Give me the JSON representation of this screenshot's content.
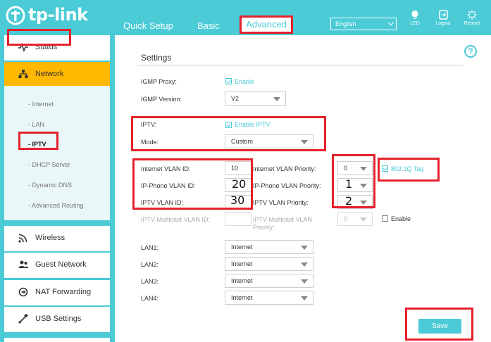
{
  "header": {
    "brand": "tp-link",
    "nav": {
      "quick_setup": "Quick Setup",
      "basic": "Basic",
      "advanced": "Advanced"
    },
    "language": "English",
    "icons": {
      "led": "LED",
      "logout": "Logout",
      "reboot": "Reboot"
    }
  },
  "sidebar": {
    "status": "Status",
    "network": "Network",
    "network_sub": [
      "Internet",
      "LAN",
      "IPTV",
      "DHCP Server",
      "Dynamic DNS",
      "Advanced Routing"
    ],
    "wireless": "Wireless",
    "guest": "Guest Network",
    "nat": "NAT Forwarding",
    "usb": "USB Settings"
  },
  "settings": {
    "title": "Settings",
    "igmp_proxy_label": "IGMP Proxy:",
    "igmp_proxy_check": "Enable",
    "igmp_version_label": "IGMP Version:",
    "igmp_version": "V2",
    "iptv_label": "IPTV:",
    "iptv_check": "Enable IPTV",
    "mode_label": "Mode:",
    "mode": "Custom",
    "internet_vlan_label": "Internet VLAN ID:",
    "internet_vlan": "10",
    "internet_prio_label": "Internet VLAN Priority:",
    "internet_prio": "0",
    "tag_check": "802.1Q Tag",
    "ipphone_vlan_label": "IP-Phone VLAN ID:",
    "ipphone_vlan": "20",
    "ipphone_prio_label": "IP-Phone VLAN Priority:",
    "ipphone_prio": "1",
    "iptv_vlan_label": "IPTV VLAN ID:",
    "iptv_vlan": "30",
    "iptv_prio_label": "IPTV VLAN Priority:",
    "iptv_prio": "2",
    "multicast_vlan_label": "IPTV Multicast VLAN ID:",
    "multicast_prio_label": "IPTV Multicast VLAN Priority:",
    "multicast_prio": "0",
    "multicast_enable": "Enable",
    "lan1_label": "LAN1:",
    "lan1": "Internet",
    "lan2_label": "LAN2:",
    "lan2": "Internet",
    "lan3_label": "LAN3:",
    "lan3": "Internet",
    "lan4_label": "LAN4:",
    "lan4": "Internet",
    "save": "Save"
  },
  "colors": {
    "accent": "#4acbd6",
    "highlight": "#ffb700",
    "annotation": "#e5212b"
  }
}
